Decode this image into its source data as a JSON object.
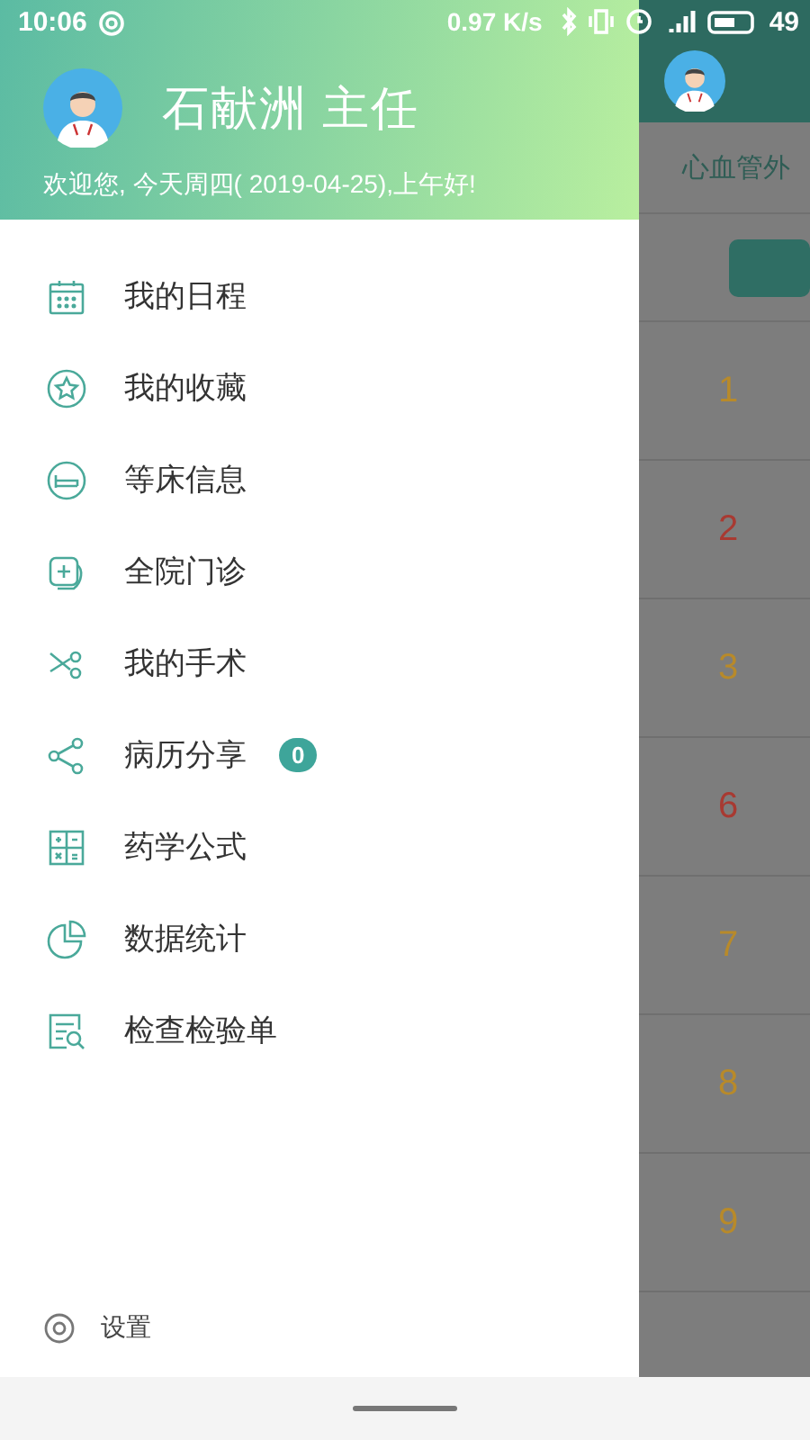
{
  "status_bar": {
    "time": "10:06",
    "speed": "0.97 K/s",
    "battery": "49"
  },
  "drawer": {
    "user_name": "石献洲 主任",
    "greeting": "欢迎您, 今天周四( 2019-04-25),上午好!",
    "menu": [
      {
        "label": "我的日程"
      },
      {
        "label": "我的收藏"
      },
      {
        "label": "等床信息"
      },
      {
        "label": "全院门诊"
      },
      {
        "label": "我的手术"
      },
      {
        "label": "病历分享",
        "badge": "0"
      },
      {
        "label": "药学公式"
      },
      {
        "label": "数据统计"
      },
      {
        "label": "检查检验单"
      }
    ],
    "settings": "设置"
  },
  "background": {
    "tab": "心血管外",
    "rows": [
      {
        "number": "1",
        "color": "#b88a2a"
      },
      {
        "number": "2",
        "color": "#a83a32"
      },
      {
        "number": "3",
        "color": "#b88a2a"
      },
      {
        "number": "6",
        "color": "#a83a32"
      },
      {
        "number": "7",
        "color": "#b88a2a"
      },
      {
        "number": "8",
        "color": "#b88a2a"
      },
      {
        "number": "9",
        "color": "#b88a2a"
      }
    ]
  }
}
